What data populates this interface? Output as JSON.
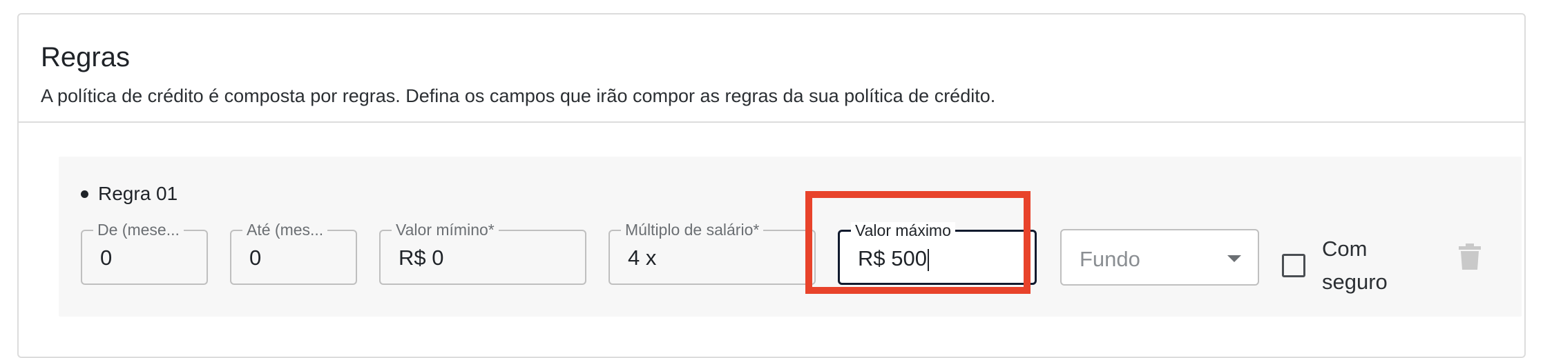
{
  "section": {
    "title": "Regras",
    "subtitle": "A política de crédito é composta por regras. Defina os campos que irão compor as regras da sua política de crédito."
  },
  "rule": {
    "label": "Regra 01",
    "fields": {
      "de": {
        "label": "De (mese...",
        "value": "0"
      },
      "ate": {
        "label": "Até (mes...",
        "value": "0"
      },
      "valor_minimo": {
        "label": "Valor mímino*",
        "value": "R$ 0"
      },
      "multiplo_salario": {
        "label": "Múltiplo de salário*",
        "value": "4 x"
      },
      "valor_maximo": {
        "label": "Valor máximo",
        "value": "R$ 500"
      }
    },
    "fundo_select": {
      "placeholder": "Fundo"
    },
    "com_seguro": {
      "label": "Com seguro",
      "checked": false
    }
  },
  "colors": {
    "highlight": "#e8432b",
    "active_border": "#111a2e",
    "panel_bg": "#f7f7f7"
  }
}
